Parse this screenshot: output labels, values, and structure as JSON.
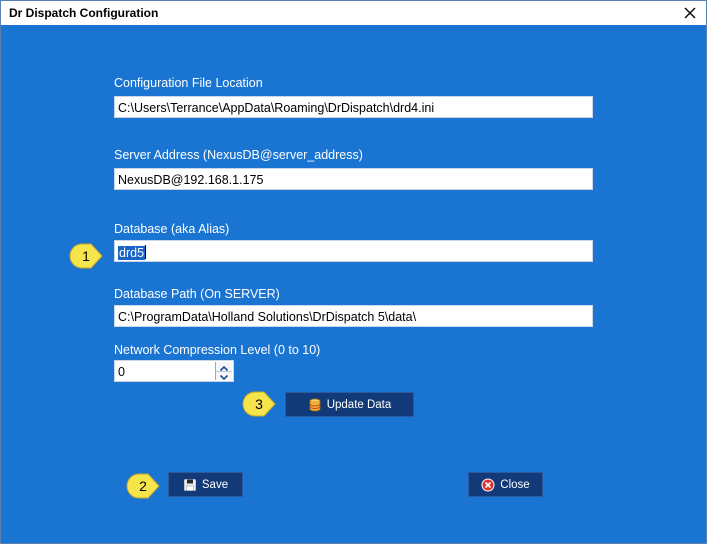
{
  "window": {
    "title": "Dr Dispatch Configuration"
  },
  "config_file": {
    "label": "Configuration File Location",
    "value": "C:\\Users\\Terrance\\AppData\\Roaming\\DrDispatch\\drd4.ini"
  },
  "server_address": {
    "label": "Server Address (NexusDB@server_address)",
    "value": "NexusDB@192.168.1.175"
  },
  "database": {
    "label": "Database (aka Alias)",
    "value": "drd5"
  },
  "database_path": {
    "label": "Database Path (On SERVER)",
    "value": "C:\\ProgramData\\Holland Solutions\\DrDispatch 5\\data\\"
  },
  "compression": {
    "label": "Network Compression Level (0 to 10)",
    "value": "0"
  },
  "buttons": {
    "update_data": "Update Data",
    "save": "Save",
    "close": "Close"
  },
  "callouts": [
    "1",
    "2",
    "3"
  ],
  "icons": {
    "update_data": "database-icon",
    "save": "floppy-disk-icon",
    "close": "close-circle-icon"
  },
  "colors": {
    "background": "#1a74d2",
    "button": "#133a78",
    "callout": "#f6e54a",
    "selection": "#1a63c9"
  }
}
